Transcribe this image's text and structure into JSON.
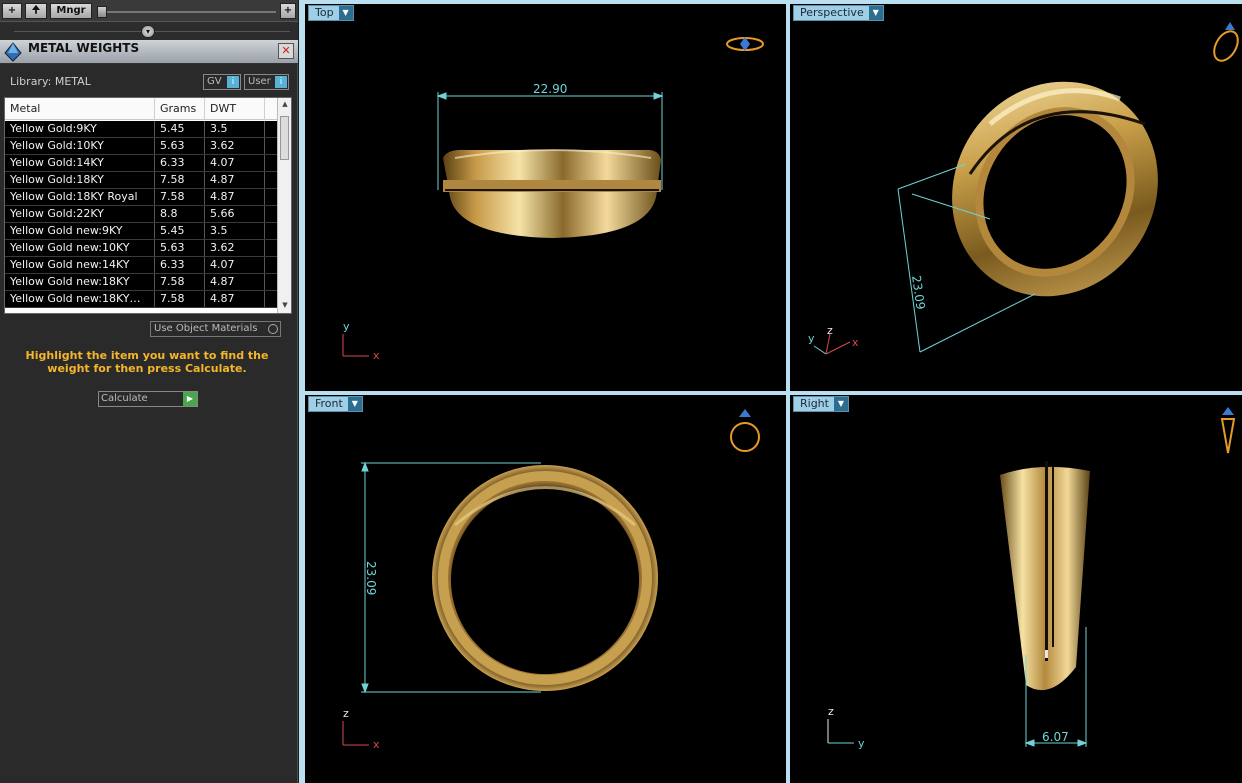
{
  "toolbar": {
    "add": "+",
    "up": "🠉",
    "manager": "Mngr",
    "plus": "+"
  },
  "panel": {
    "title": "METAL WEIGHTS",
    "close": "✕",
    "library_label": "Library: METAL",
    "gv_label": "GV",
    "user_label": "User",
    "columns": [
      "Metal",
      "Grams",
      "DWT"
    ],
    "rows": [
      [
        "Yellow Gold:9KY",
        "5.45",
        "3.5"
      ],
      [
        "Yellow Gold:10KY",
        "5.63",
        "3.62"
      ],
      [
        "Yellow Gold:14KY",
        "6.33",
        "4.07"
      ],
      [
        "Yellow Gold:18KY",
        "7.58",
        "4.87"
      ],
      [
        "Yellow Gold:18KY Royal",
        "7.58",
        "4.87"
      ],
      [
        "Yellow Gold:22KY",
        "8.8",
        "5.66"
      ],
      [
        "Yellow Gold new:9KY",
        "5.45",
        "3.5"
      ],
      [
        "Yellow Gold new:10KY",
        "5.63",
        "3.62"
      ],
      [
        "Yellow Gold new:14KY",
        "6.33",
        "4.07"
      ],
      [
        "Yellow Gold new:18KY",
        "7.58",
        "4.87"
      ],
      [
        "Yellow Gold new:18KY…",
        "7.58",
        "4.87"
      ]
    ],
    "use_object_materials": "Use Object Materials",
    "hint": "Highlight the item you want to find the weight for then press Calculate.",
    "calculate": "Calculate"
  },
  "viewports": {
    "top": {
      "label": "Top",
      "dimension": "22.90",
      "axis_y": "y",
      "axis_x": "x"
    },
    "perspective": {
      "label": "Perspective",
      "dimension": "23.09",
      "axis_y": "y",
      "axis_z": "z",
      "axis_x": "x"
    },
    "front": {
      "label": "Front",
      "dimension": "23.09",
      "axis_z": "z",
      "axis_x": "x"
    },
    "right": {
      "label": "Right",
      "dimension": "6.07",
      "axis_z": "z",
      "axis_y": "y"
    }
  },
  "colors": {
    "accent": "#9fcfe6",
    "gold": "#d9b05a",
    "dimension": "#6fd3d7",
    "hint": "#f4b62a"
  }
}
